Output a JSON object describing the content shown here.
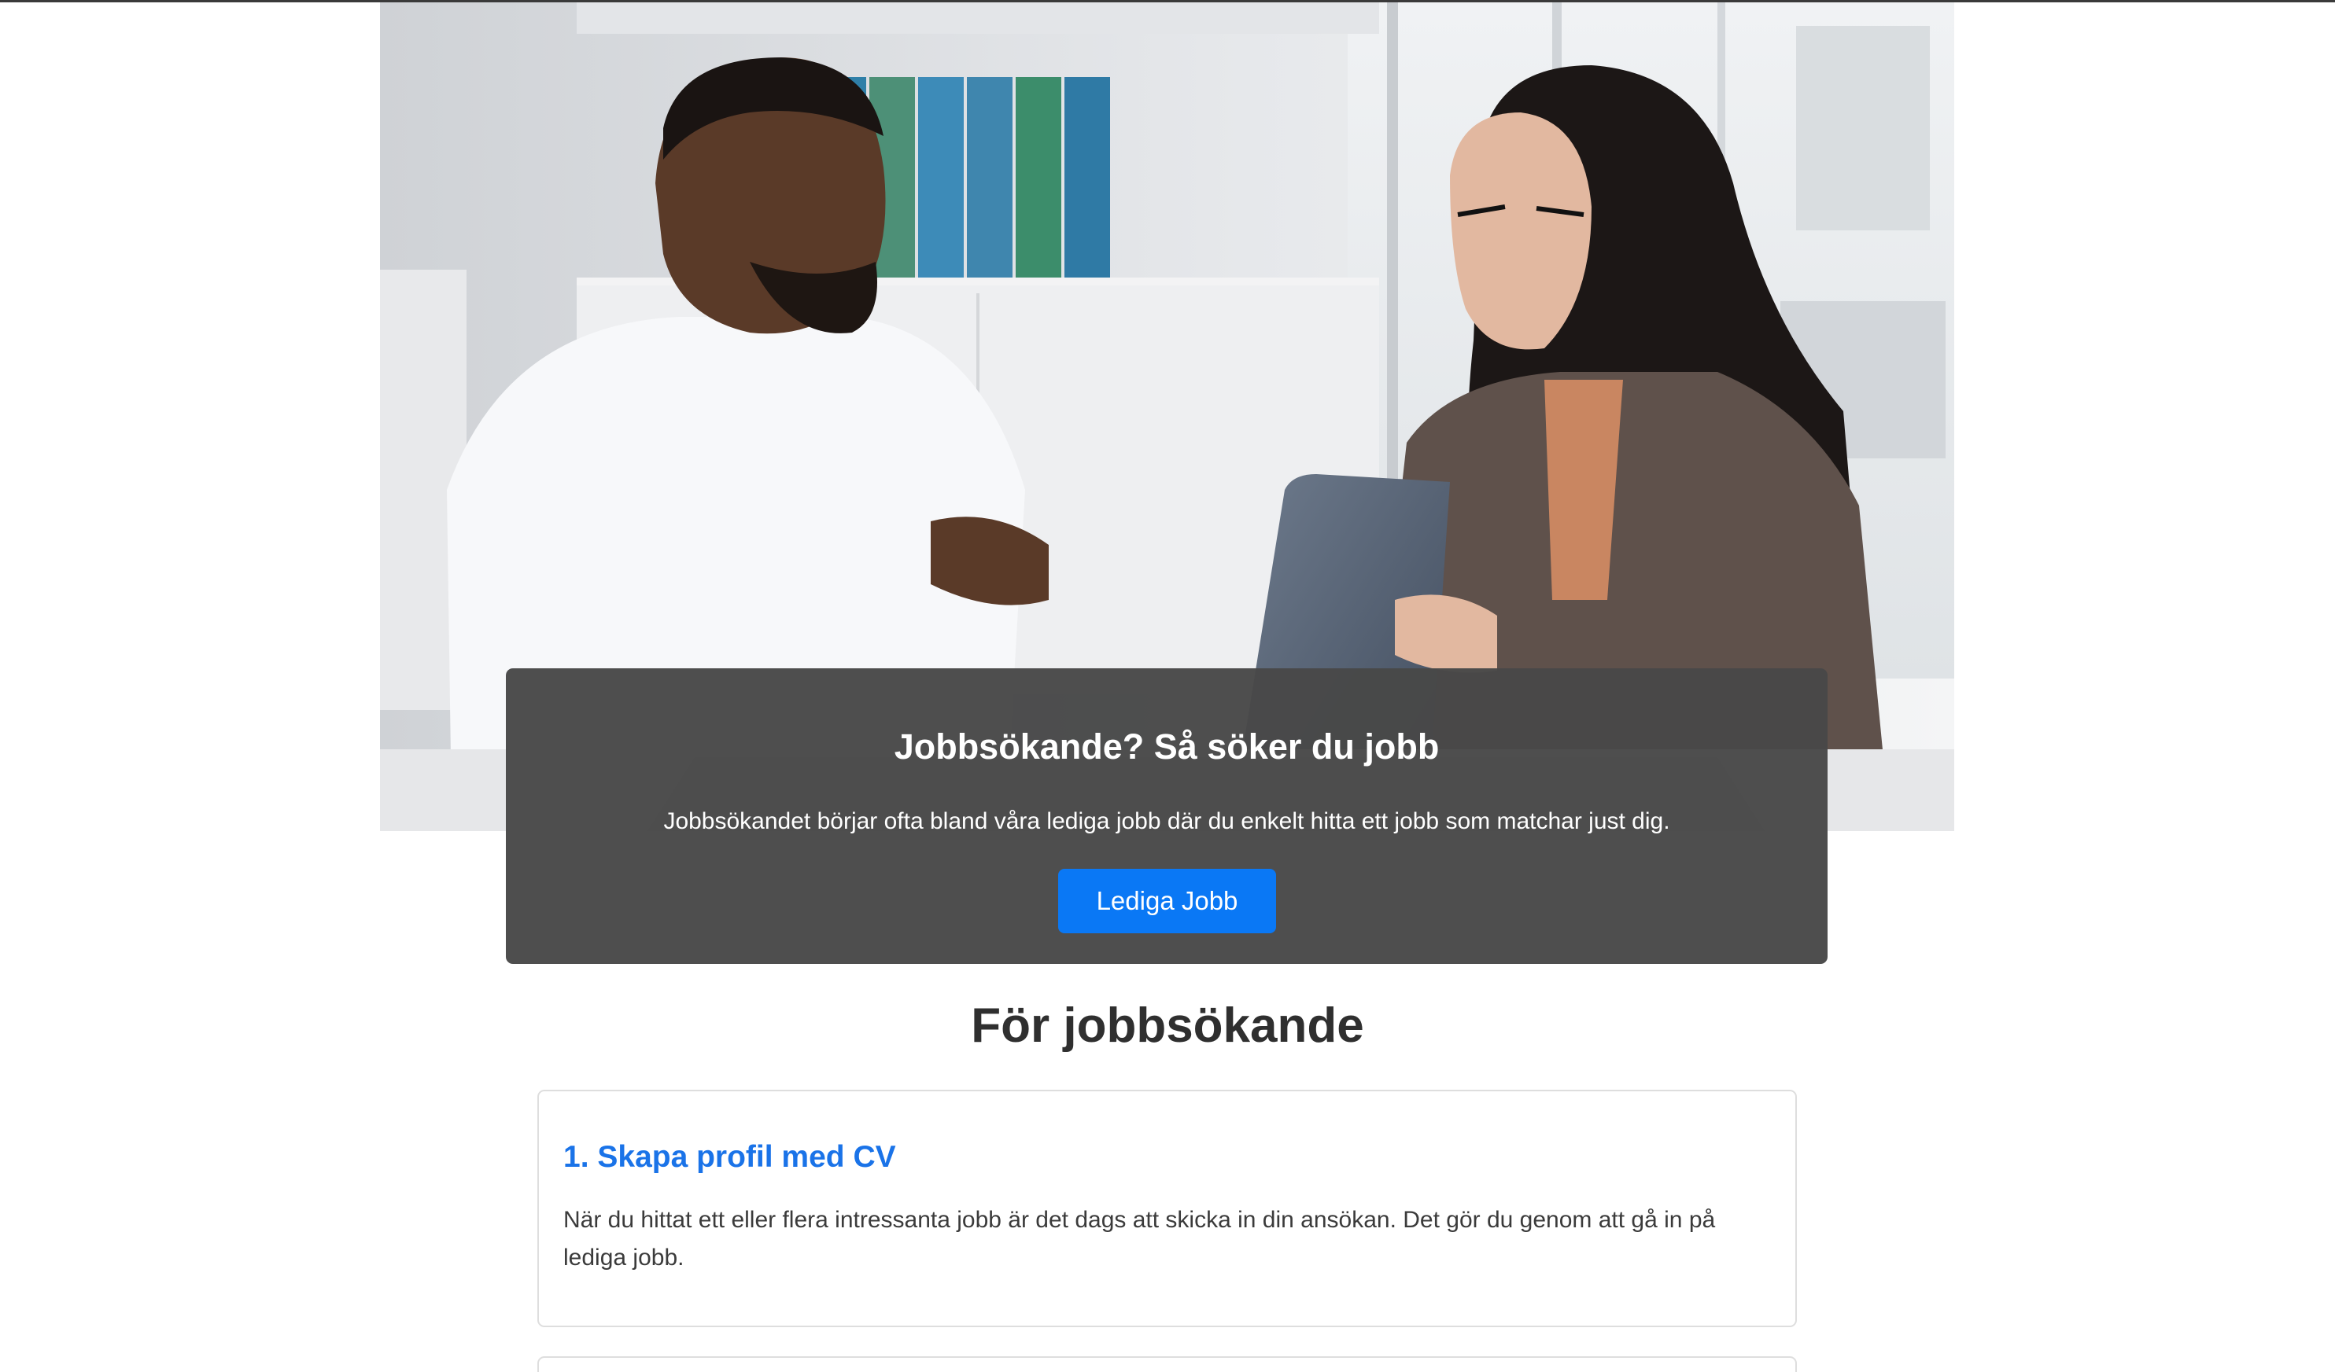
{
  "hero": {
    "image_description": "hero-office-meeting",
    "heading": "Jobbsökande? Så söker du jobb",
    "text": "Jobbsökandet börjar ofta bland våra lediga jobb där du enkelt hitta ett jobb som matchar just dig.",
    "button_label": "Lediga Jobb"
  },
  "section": {
    "title": "För jobbsökande"
  },
  "cards": [
    {
      "title": "1. Skapa profil med CV",
      "text": "När du hittat ett eller flera intressanta jobb är det dags att skicka in din ansökan. Det gör du genom att gå in på lediga jobb."
    }
  ],
  "colors": {
    "accent": "#0a78f5",
    "card_title": "#1a73e8",
    "overlay": "#484848",
    "text": "#2f2f2f"
  }
}
